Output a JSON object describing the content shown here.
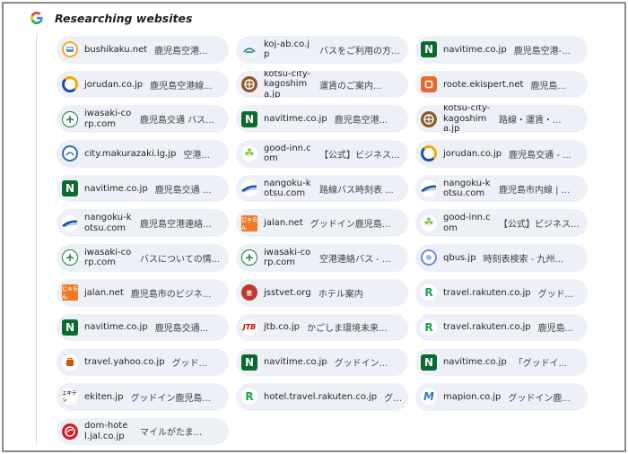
{
  "header": {
    "title": "Researching websites",
    "icon": "google-g-icon"
  },
  "sources": [
    {
      "domain": "bushikaku.net",
      "title": "鹿児島空港...",
      "icon": "bushikaku-icon",
      "wrap": false
    },
    {
      "domain": "koj-ab.co.jp",
      "title": "バスをご利用の方 ...",
      "icon": "koj-icon",
      "wrap": true
    },
    {
      "domain": "navitime.co.jp",
      "title": "鹿児島空港-...",
      "icon": "navitime-icon",
      "wrap": false
    },
    {
      "domain": "jorudan.co.jp",
      "title": "鹿児島空港線...",
      "icon": "jorudan-icon",
      "wrap": false
    },
    {
      "domain": "kotsu-city-kagoshima.jp",
      "title": "運賃のご案内...",
      "icon": "kotsu-city-icon",
      "wrap": true
    },
    {
      "domain": "roote.ekispert.net",
      "title": "鹿児島...",
      "icon": "ekispert-icon",
      "wrap": false
    },
    {
      "domain": "iwasaki-corp.com",
      "title": "鹿児島交通 バス...",
      "icon": "iwasaki-icon",
      "wrap": true
    },
    {
      "domain": "navitime.co.jp",
      "title": "鹿児島空港...",
      "icon": "navitime-icon",
      "wrap": false
    },
    {
      "domain": "kotsu-city-kagoshima.jp",
      "title": "路線・運賃・...",
      "icon": "kotsu-city-icon",
      "wrap": true
    },
    {
      "domain": "city.makurazaki.lg.jp",
      "title": "空港...",
      "icon": "makurazaki-icon",
      "wrap": false
    },
    {
      "domain": "good-inn.com",
      "title": "【公式】ビジネス...",
      "icon": "good-inn-icon",
      "wrap": true
    },
    {
      "domain": "jorudan.co.jp",
      "title": "鹿児島交通 - ...",
      "icon": "jorudan-icon",
      "wrap": false
    },
    {
      "domain": "navitime.co.jp",
      "title": "鹿児島交通 ...",
      "icon": "navitime-icon",
      "wrap": false
    },
    {
      "domain": "nangoku-kotsu.com",
      "title": "路線バス時刻表 ...",
      "icon": "nangoku-icon",
      "wrap": true
    },
    {
      "domain": "nangoku-kotsu.com",
      "title": "鹿児島市内線 | ...",
      "icon": "nangoku-icon",
      "wrap": true
    },
    {
      "domain": "nangoku-kotsu.com",
      "title": "鹿児島空港連絡...",
      "icon": "nangoku-icon",
      "wrap": true
    },
    {
      "domain": "jalan.net",
      "title": "グッドイン鹿児島...",
      "icon": "jalan-icon",
      "wrap": false
    },
    {
      "domain": "good-inn.com",
      "title": "【公式】ビジネス...",
      "icon": "good-inn-icon",
      "wrap": true
    },
    {
      "domain": "iwasaki-corp.com",
      "title": "バスについての情...",
      "icon": "iwasaki-icon",
      "wrap": true
    },
    {
      "domain": "iwasaki-corp.com",
      "title": "空港連絡バス - ...",
      "icon": "iwasaki-icon",
      "wrap": true
    },
    {
      "domain": "qbus.jp",
      "title": "時刻表検索 - 九州...",
      "icon": "qbus-icon",
      "wrap": false
    },
    {
      "domain": "jalan.net",
      "title": "鹿児島市のビジネ...",
      "icon": "jalan-icon",
      "wrap": false
    },
    {
      "domain": "jsstvet.org",
      "title": "ホテル案内",
      "icon": "jsstvet-icon",
      "wrap": false
    },
    {
      "domain": "travel.rakuten.co.jp",
      "title": "グッド...",
      "icon": "rakuten-icon",
      "wrap": false
    },
    {
      "domain": "navitime.co.jp",
      "title": "鹿児島交通...",
      "icon": "navitime-icon",
      "wrap": false
    },
    {
      "domain": "jtb.co.jp",
      "title": "かごしま環境未来...",
      "icon": "jtb-icon",
      "wrap": false
    },
    {
      "domain": "travel.rakuten.co.jp",
      "title": "鹿児島...",
      "icon": "rakuten-icon",
      "wrap": false
    },
    {
      "domain": "travel.yahoo.co.jp",
      "title": "グッド...",
      "icon": "yahoo-travel-icon",
      "wrap": false
    },
    {
      "domain": "navitime.co.jp",
      "title": "グッドイン...",
      "icon": "navitime-icon",
      "wrap": false
    },
    {
      "domain": "navitime.co.jp",
      "title": "「グッドイ...",
      "icon": "navitime-icon",
      "wrap": false
    },
    {
      "domain": "ekiten.jp",
      "title": "グッドイン鹿児島...",
      "icon": "ekiten-icon",
      "wrap": false
    },
    {
      "domain": "hotel.travel.rakuten.co.jp",
      "title": "グ...",
      "icon": "rakuten-icon",
      "wrap": false
    },
    {
      "domain": "mapion.co.jp",
      "title": "グッドイン鹿...",
      "icon": "mapion-icon",
      "wrap": false
    },
    {
      "domain": "dom-hotel.jal.co.jp",
      "title": "マイルがたま...",
      "icon": "jal-icon",
      "wrap": true
    }
  ]
}
